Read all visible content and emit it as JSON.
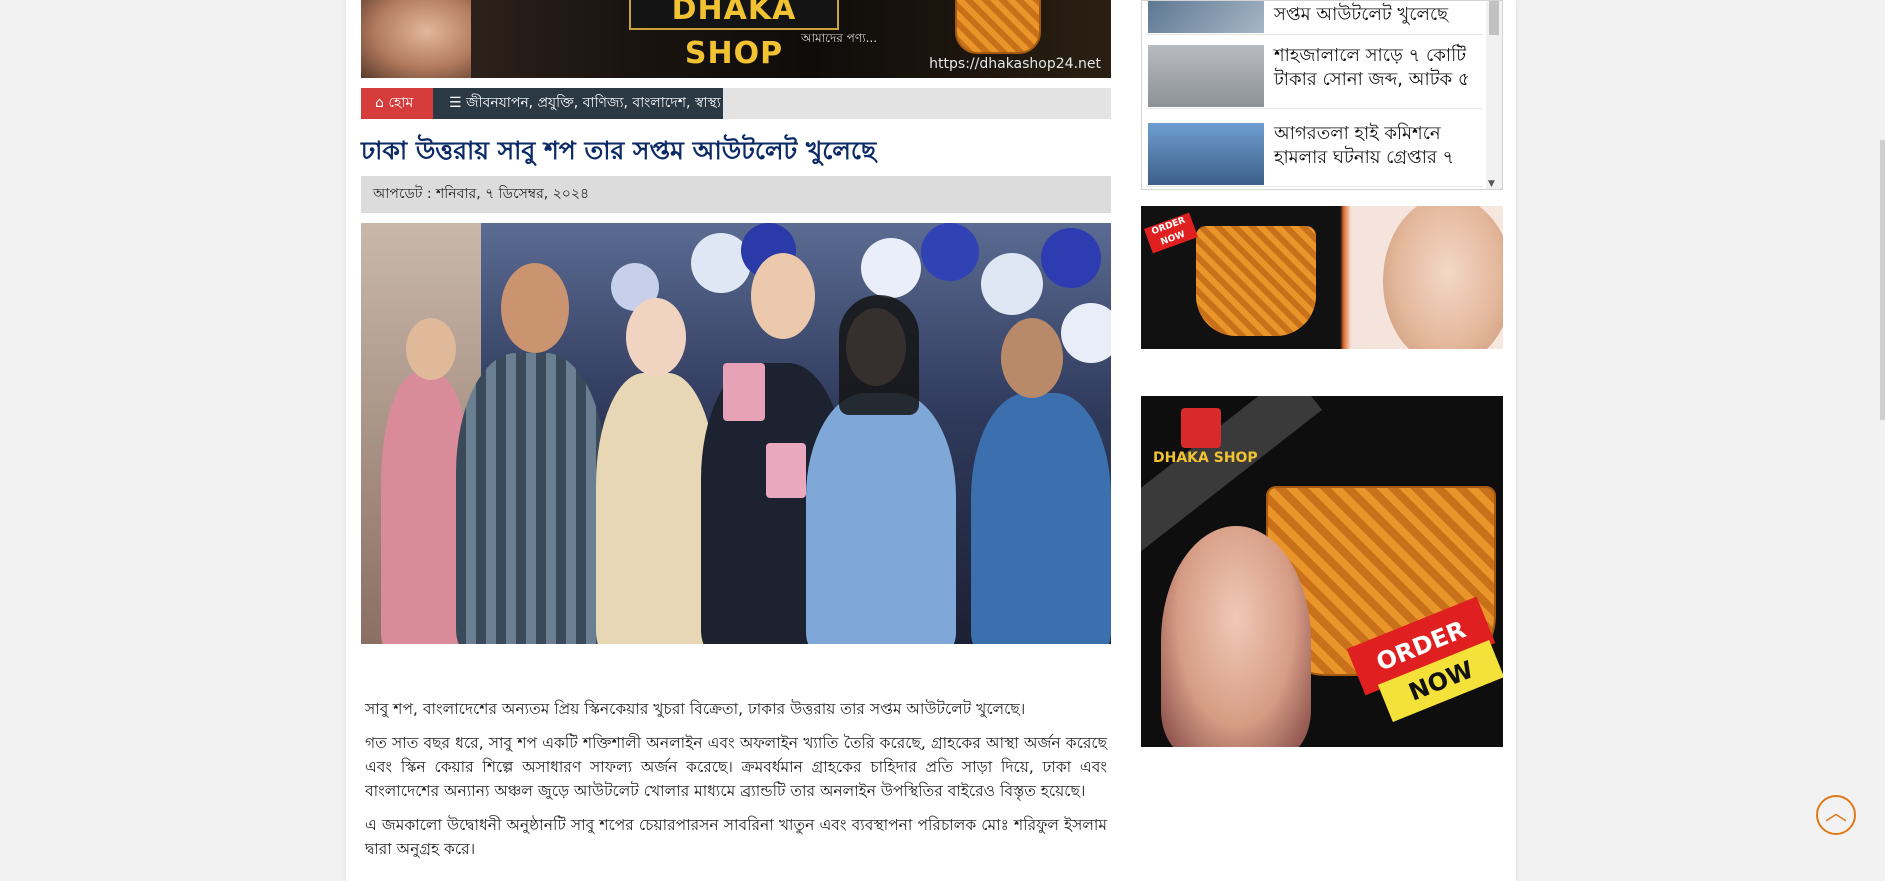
{
  "banner": {
    "shop_name": "DHAKA SHOP",
    "tagline": "আমাদের পণ্য...",
    "url": "https://dhakashop24.net"
  },
  "breadcrumb": {
    "home_icon": "home-icon",
    "home_label": "হোম",
    "menu_icon": "bars-icon",
    "categories": "জীবনযাপন, প্রযুক্তি, বাণিজ্য, বাংলাদেশ, স্বাস্থ্য"
  },
  "article": {
    "title": "ঢাকা উত্তরায় সাবু শপ তার সপ্তম আউটলেট খুলেছে",
    "update": "আপডেট : শনিবার, ৭ ডিসেম্বর, ২০২৪",
    "paragraphs": [
      "সাবু শপ, বাংলাদেশের অন্যতম প্রিয় স্কিনকেয়ার খুচরা বিক্রেতা, ঢাকার উত্তরায় তার সপ্তম আউটলেট খুলেছে।",
      "গত সাত বছর ধরে, সাবু শপ একটি শক্তিশালী অনলাইন এবং অফলাইন খ্যাতি তৈরি করেছে, গ্রাহকের আস্থা অর্জন করেছে এবং স্কিন কেয়ার শিল্পে অসাধারণ সাফল্য অর্জন করেছে। ক্রমবর্ধমান গ্রাহকের চাহিদার প্রতি সাড়া দিয়ে, ঢাকা এবং বাংলাদেশের অন্যান্য অঞ্চল জুড়ে আউটলেট খোলার মাধ্যমে ব্র্যান্ডটি তার অনলাইন উপস্থিতির বাইরেও বিস্তৃত হয়েছে।",
      "এ জমকালো উদ্বোধনী অনুষ্ঠানটি সাবু শপের চেয়ারপারসন সাবরিনা খাতুন এবং ব্যবস্থাপনা পরিচালক মোঃ শরিফুল ইসলাম দ্বারা অনুগ্রহ করে।"
    ]
  },
  "sidebar": {
    "news": [
      {
        "title": "সপ্তম আউটলেট খুলেছে"
      },
      {
        "title": "শাহজালালে সাড়ে ৭ কোটি টাকার সোনা জব্দ, আটক ৫"
      },
      {
        "title": "আগরতলা হাই কমিশনে হামলার ঘটনায় গ্রেপ্তার ৭"
      }
    ],
    "ad1": {
      "badge": "ORDER NOW"
    },
    "ad2": {
      "brand": "DHAKA SHOP",
      "badge_line1": "ORDER",
      "badge_line2": "NOW"
    }
  },
  "scroll_top_icon": "chevron-up-circle-icon"
}
